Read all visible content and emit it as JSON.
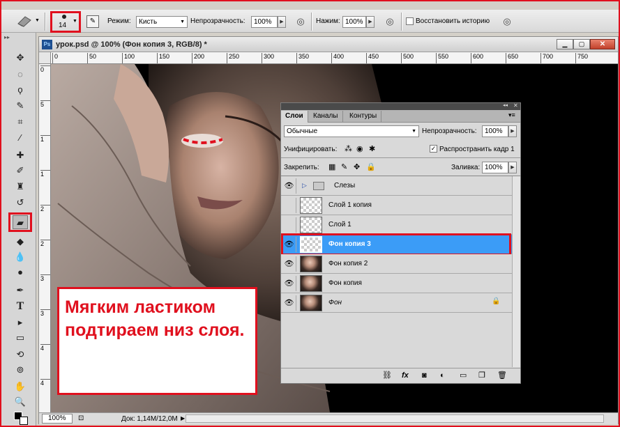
{
  "options_bar": {
    "brush_size": "14",
    "mode_label": "Режим:",
    "mode_value": "Кисть",
    "opacity_label": "Непрозрачность:",
    "opacity_value": "100%",
    "pressure_label": "Нажим:",
    "pressure_value": "100%",
    "restore_history_label": "Восстановить историю"
  },
  "document": {
    "title": "урок.psd @ 100% (Фон копия 3, RGB/8) *",
    "ruler_h": [
      "0",
      "50",
      "100",
      "150",
      "200",
      "250",
      "300",
      "350",
      "400",
      "450",
      "500",
      "550",
      "600",
      "650",
      "700",
      "750"
    ],
    "ruler_v": [
      "0",
      "5",
      "1",
      "1",
      "2",
      "2",
      "3",
      "3",
      "4",
      "4"
    ],
    "zoom": "100%",
    "doc_size": "Док: 1,14M/12,0M"
  },
  "layers_panel": {
    "tabs": [
      "Слои",
      "Каналы",
      "Контуры"
    ],
    "blend_mode": "Обычные",
    "opacity_label": "Непрозрачность:",
    "opacity_value": "100%",
    "unify_label": "Унифицировать:",
    "propagate_label": "Распространить кадр 1",
    "lock_label": "Закрепить:",
    "fill_label": "Заливка:",
    "fill_value": "100%",
    "layers": [
      {
        "name": "Слезы",
        "visible": true,
        "type": "group"
      },
      {
        "name": "Слой 1 копия",
        "visible": false,
        "type": "transparent"
      },
      {
        "name": "Слой 1",
        "visible": false,
        "type": "transparent"
      },
      {
        "name": "Фон копия 3",
        "visible": true,
        "type": "transparent",
        "selected": true
      },
      {
        "name": "Фон копия 2",
        "visible": true,
        "type": "photo"
      },
      {
        "name": "Фон копия",
        "visible": true,
        "type": "photo"
      },
      {
        "name": "Фон",
        "visible": true,
        "type": "photo",
        "locked": true
      }
    ]
  },
  "annotation": {
    "text": "Мягким ластиком подтираем низ слоя."
  },
  "colors": {
    "highlight": "#e0101e",
    "selected_layer": "#3b9cf7"
  }
}
